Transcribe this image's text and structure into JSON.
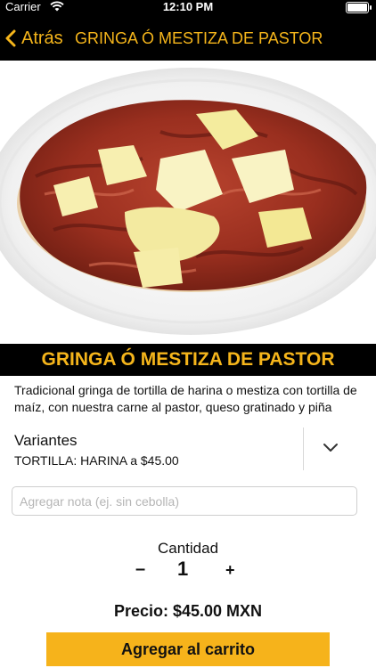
{
  "status_bar": {
    "carrier": "Carrier",
    "time": "12:10 PM"
  },
  "nav": {
    "back_label": "Atrás",
    "title": "GRINGA Ó MESTIZA DE PASTOR"
  },
  "product": {
    "name": "GRINGA Ó MESTIZA DE PASTOR",
    "description": "Tradicional gringa de tortilla de harina o mestiza con tortilla de maíz, con nuestra carne al pastor, queso gratinado y piña"
  },
  "variants": {
    "title": "Variantes",
    "selected": "TORTILLA: HARINA a $45.00"
  },
  "note": {
    "placeholder": "Agregar nota (ej. sin cebolla)",
    "value": ""
  },
  "quantity": {
    "label": "Cantidad",
    "minus": "–",
    "value": "1",
    "plus": "+"
  },
  "price": {
    "text": "Precio: $45.00 MXN"
  },
  "cart_button": {
    "label": "Agregar al carrito"
  },
  "colors": {
    "accent": "#f5b51b",
    "bar": "#000000"
  }
}
